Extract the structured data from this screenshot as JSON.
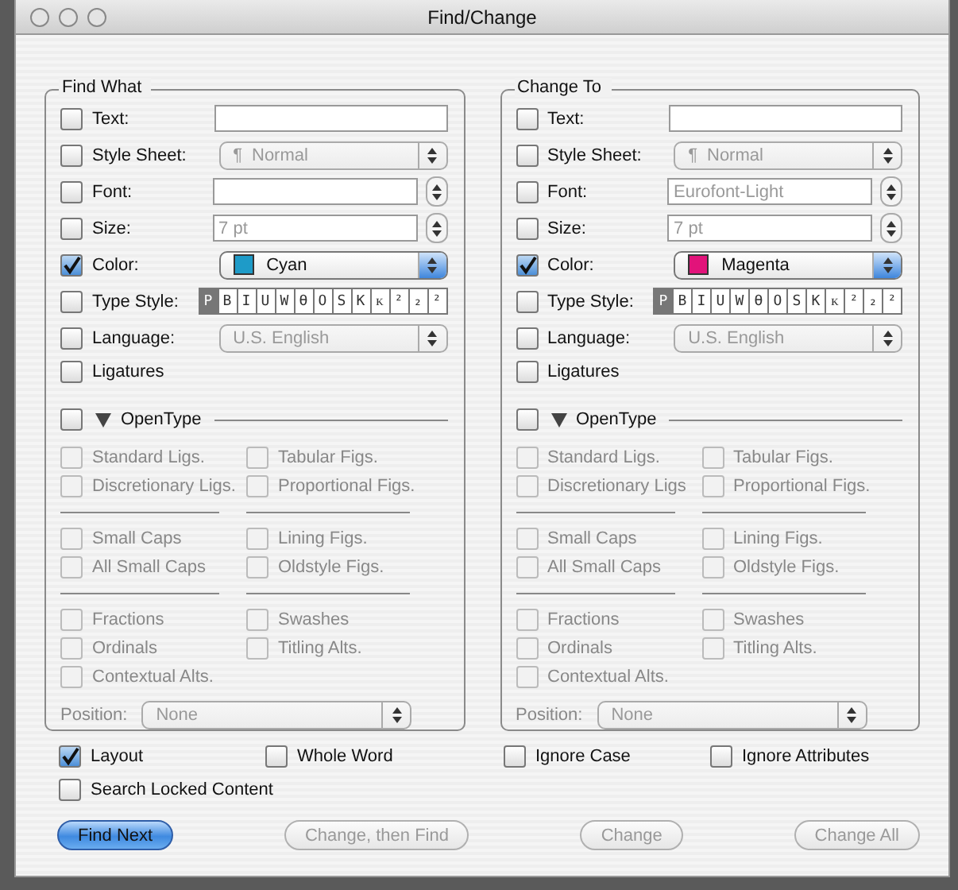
{
  "window": {
    "title": "Find/Change"
  },
  "panels": [
    {
      "title": "Find What",
      "fields": [
        {
          "kind": "text",
          "label": "Text:",
          "checked": false
        },
        {
          "kind": "popup",
          "label": "Style Sheet:",
          "checked": false,
          "glyph": "¶",
          "value": "Normal"
        },
        {
          "kind": "stepper",
          "label": "Font:",
          "checked": false
        },
        {
          "kind": "stepper",
          "label": "Size:",
          "checked": false,
          "placeholder": "7 pt"
        },
        {
          "kind": "color",
          "label": "Color:",
          "checked": true,
          "value": "Cyan",
          "color": "#1e9bc8"
        },
        {
          "kind": "styles",
          "label": "Type Style:",
          "checked": false,
          "styles": [
            {
              "label": "P",
              "selected": true
            },
            {
              "label": "B",
              "selected": false
            },
            {
              "label": "I",
              "selected": false
            },
            {
              "label": "U",
              "selected": false
            },
            {
              "label": "W",
              "selected": false
            },
            {
              "label": "Ө",
              "selected": false
            },
            {
              "label": "O",
              "selected": false
            },
            {
              "label": "S",
              "selected": false
            },
            {
              "label": "K",
              "selected": false
            },
            {
              "label": "ᴋ",
              "selected": false
            },
            {
              "label": "²",
              "selected": false
            },
            {
              "label": "₂",
              "selected": false
            },
            {
              "label": "²",
              "selected": false
            }
          ]
        },
        {
          "kind": "popup",
          "label": "Language:",
          "checked": false,
          "value": "U.S. English"
        },
        {
          "kind": "check",
          "label": "Ligatures",
          "checked": false
        }
      ],
      "opentype": {
        "label": "OpenType",
        "checked": false,
        "expanded": true,
        "disabled": true,
        "groups": [
          [
            {
              "label": "Standard Ligs.",
              "checked": false
            },
            {
              "label": "Tabular Figs.",
              "checked": false
            },
            {
              "label": "Discretionary Ligs.",
              "checked": false
            },
            {
              "label": "Proportional Figs.",
              "checked": false
            }
          ],
          [
            {
              "label": "Small Caps",
              "checked": false
            },
            {
              "label": "Lining Figs.",
              "checked": false
            },
            {
              "label": "All Small Caps",
              "checked": false
            },
            {
              "label": "Oldstyle Figs.",
              "checked": false
            }
          ],
          [
            {
              "label": "Fractions",
              "checked": false
            },
            {
              "label": "Swashes",
              "checked": false
            },
            {
              "label": "Ordinals",
              "checked": false
            },
            {
              "label": "Titling Alts.",
              "checked": false
            },
            {
              "label": "Contextual Alts.",
              "checked": false
            }
          ]
        ],
        "position": {
          "label": "Position:",
          "value": "None"
        }
      }
    },
    {
      "title": "Change To",
      "fields": [
        {
          "kind": "text",
          "label": "Text:",
          "checked": false
        },
        {
          "kind": "popup",
          "label": "Style Sheet:",
          "checked": false,
          "glyph": "¶",
          "value": "Normal"
        },
        {
          "kind": "stepper",
          "label": "Font:",
          "checked": false,
          "placeholder": "Eurofont-Light"
        },
        {
          "kind": "stepper",
          "label": "Size:",
          "checked": false,
          "placeholder": "7 pt"
        },
        {
          "kind": "color",
          "label": "Color:",
          "checked": true,
          "value": "Magenta",
          "color": "#e2137a"
        },
        {
          "kind": "styles",
          "label": "Type Style:",
          "checked": false,
          "styles": [
            {
              "label": "P",
              "selected": true
            },
            {
              "label": "B",
              "selected": false
            },
            {
              "label": "I",
              "selected": false
            },
            {
              "label": "U",
              "selected": false
            },
            {
              "label": "W",
              "selected": false
            },
            {
              "label": "Ө",
              "selected": false
            },
            {
              "label": "O",
              "selected": false
            },
            {
              "label": "S",
              "selected": false
            },
            {
              "label": "K",
              "selected": false
            },
            {
              "label": "ᴋ",
              "selected": false
            },
            {
              "label": "²",
              "selected": false
            },
            {
              "label": "₂",
              "selected": false
            },
            {
              "label": "²",
              "selected": false
            }
          ]
        },
        {
          "kind": "popup",
          "label": "Language:",
          "checked": false,
          "value": "U.S. English"
        },
        {
          "kind": "check",
          "label": "Ligatures",
          "checked": false
        }
      ],
      "opentype": {
        "label": "OpenType",
        "checked": false,
        "expanded": true,
        "disabled": true,
        "groups": [
          [
            {
              "label": "Standard Ligs.",
              "checked": false
            },
            {
              "label": "Tabular Figs.",
              "checked": false
            },
            {
              "label": "Discretionary Ligs",
              "checked": false
            },
            {
              "label": "Proportional Figs.",
              "checked": false
            }
          ],
          [
            {
              "label": "Small Caps",
              "checked": false
            },
            {
              "label": "Lining Figs.",
              "checked": false
            },
            {
              "label": "All Small Caps",
              "checked": false
            },
            {
              "label": "Oldstyle Figs.",
              "checked": false
            }
          ],
          [
            {
              "label": "Fractions",
              "checked": false
            },
            {
              "label": "Swashes",
              "checked": false
            },
            {
              "label": "Ordinals",
              "checked": false
            },
            {
              "label": "Titling Alts.",
              "checked": false
            },
            {
              "label": "Contextual Alts.",
              "checked": false
            }
          ]
        ],
        "position": {
          "label": "Position:",
          "value": "None"
        }
      }
    }
  ],
  "options": [
    {
      "label": "Layout",
      "checked": true
    },
    {
      "label": "Whole Word",
      "checked": false
    },
    {
      "label": "Ignore Case",
      "checked": false
    },
    {
      "label": "Ignore Attributes",
      "checked": false
    },
    {
      "label": "Search Locked Content",
      "checked": false
    }
  ],
  "buttons": [
    {
      "label": "Find Next",
      "default": true,
      "disabled": false
    },
    {
      "label": "Change, then Find",
      "default": false,
      "disabled": true
    },
    {
      "label": "Change",
      "default": false,
      "disabled": true
    },
    {
      "label": "Change All",
      "default": false,
      "disabled": true
    }
  ]
}
